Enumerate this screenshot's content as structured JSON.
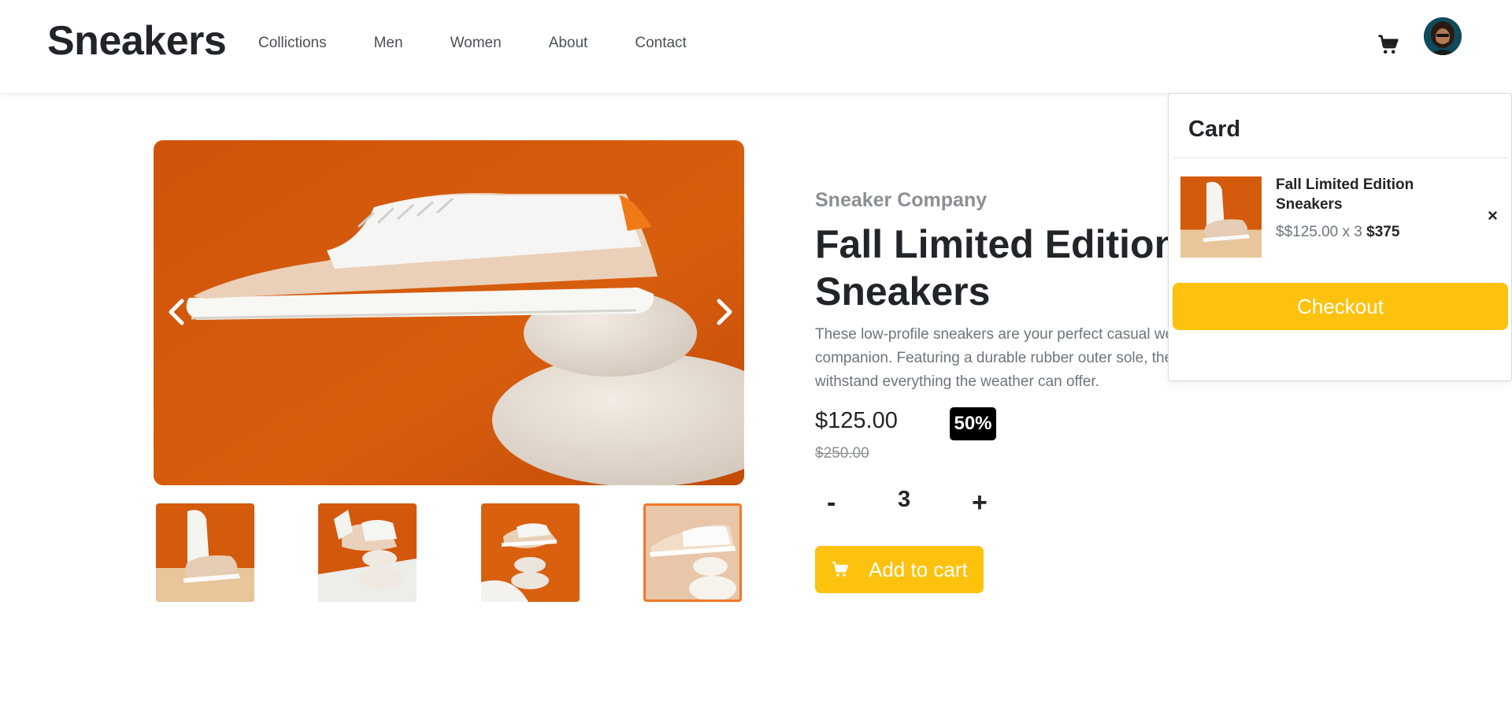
{
  "header": {
    "logo": "Sneakers",
    "nav": [
      "Collictions",
      "Men",
      "Women",
      "About",
      "Contact"
    ]
  },
  "gallery": {
    "thumbnail_count": 4,
    "active_thumbnail": 4
  },
  "product": {
    "company": "Sneaker Company",
    "title": "Fall Limited Edition Sneakers",
    "description": "These low-profile sneakers are your perfect casual wear companion. Featuring a durable rubber outer sole, they'll withstand everything the weather can offer.",
    "price": "$125.00",
    "discount": "50%",
    "old_price": "$250.00",
    "quantity": "3",
    "minus_label": "-",
    "plus_label": "+",
    "add_to_cart_label": "Add to cart"
  },
  "cart": {
    "title": "Card",
    "item": {
      "name": "Fall Limited Edition Sneakers",
      "unit_price_text": "$$125.00 x 3",
      "total": "$375"
    },
    "remove_label": "×",
    "checkout_label": "Checkout"
  },
  "colors": {
    "accent": "#fcc20e",
    "product_bg": "#d85a0c",
    "active_thumb_border": "#f2711c",
    "discount_bg": "#000000"
  },
  "icons": {
    "cart": "cart-icon",
    "avatar": "avatar",
    "prev": "chevron-left-icon",
    "next": "chevron-right-icon",
    "close": "close-icon"
  }
}
